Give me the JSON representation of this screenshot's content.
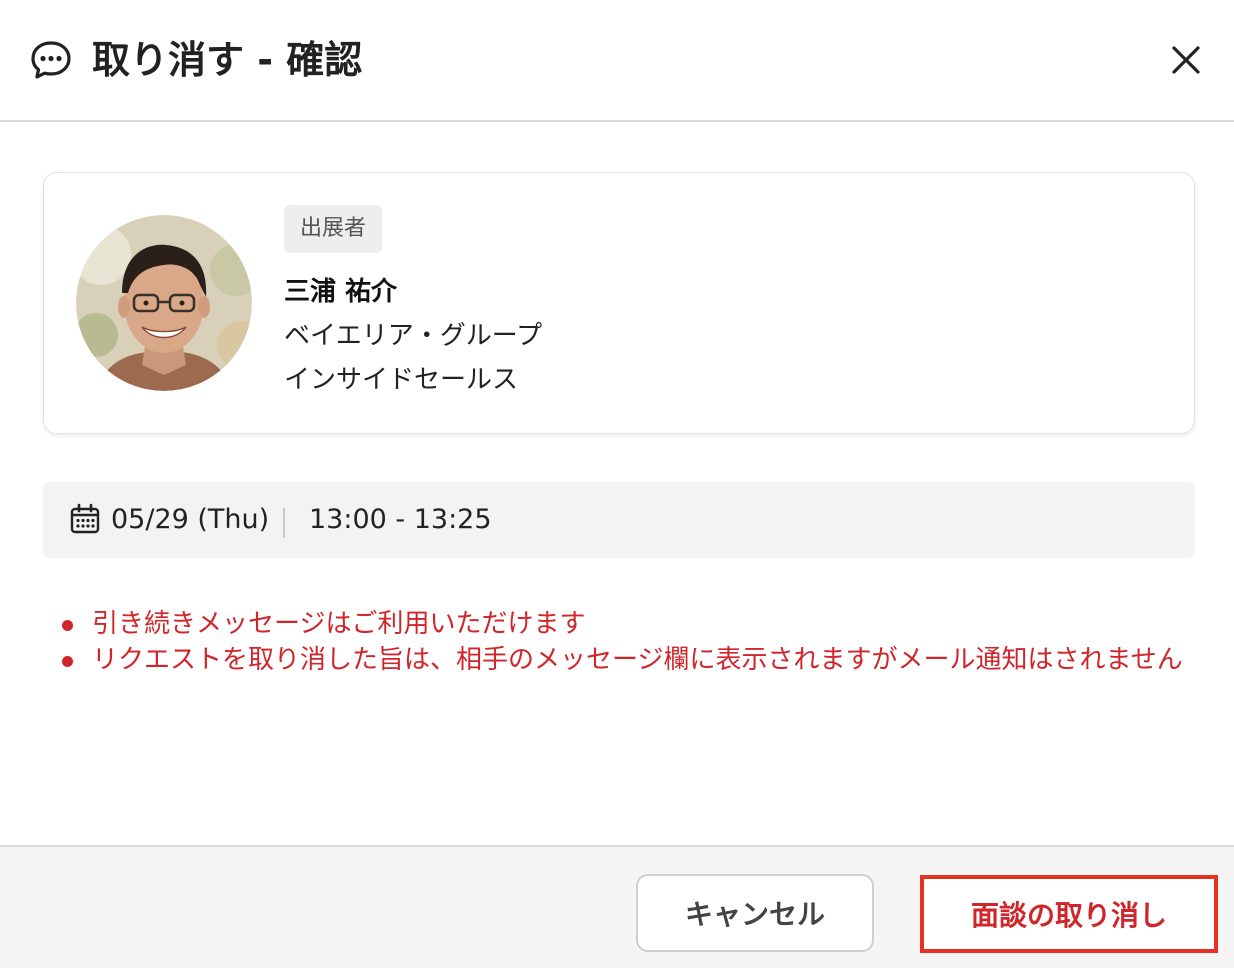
{
  "header": {
    "title": "取り消す - 確認",
    "icon": "chat-bubble-icon",
    "close_icon": "close-icon"
  },
  "profile": {
    "role_badge": "出展者",
    "name": "三浦 祐介",
    "company": "ベイエリア・グループ",
    "department": "インサイドセールス",
    "avatar": "avatar-photo"
  },
  "schedule": {
    "icon": "calendar-icon",
    "date": "05/29 (Thu)",
    "time": "13:00 - 13:25"
  },
  "notes": [
    "引き続きメッセージはご利用いただけます",
    "リクエストを取り消した旨は、相手のメッセージ欄に表示されますがメール通知はされません"
  ],
  "footer": {
    "cancel_label": "キャンセル",
    "confirm_label": "面談の取り消し"
  },
  "colors": {
    "accent_red": "#d0262b",
    "highlight_border": "#e53222",
    "divider": "#d9d9d9",
    "schedule_bg": "#f3f3f3",
    "footer_bg": "#f5f5f5"
  }
}
